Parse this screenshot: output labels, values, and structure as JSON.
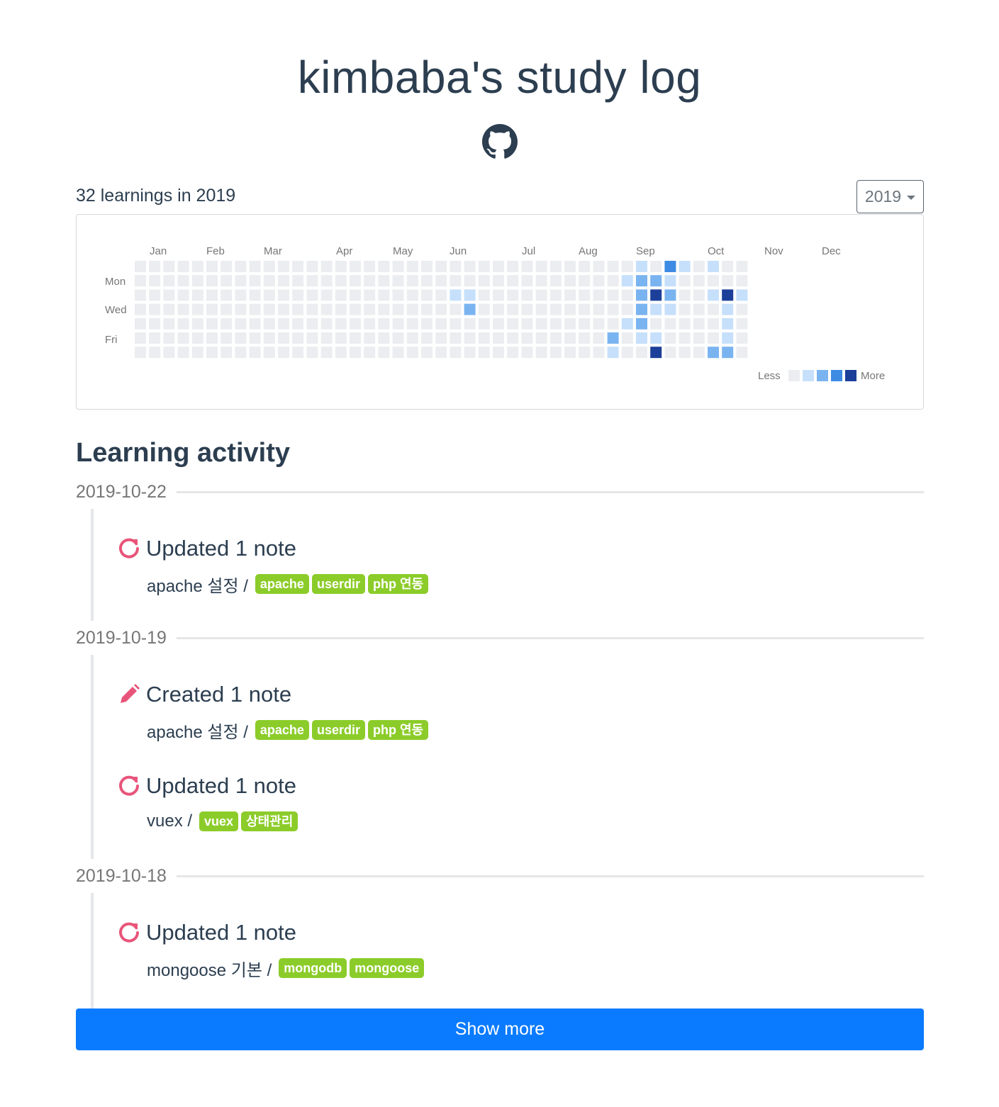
{
  "header": {
    "title": "kimbaba's study log",
    "github_icon": "github-icon"
  },
  "summary": {
    "text": "32 learnings in 2019",
    "year_selected": "2019"
  },
  "calendar": {
    "months": [
      "Jan",
      "Feb",
      "Mar",
      "Apr",
      "May",
      "Jun",
      "Jul",
      "Aug",
      "Sep",
      "Oct",
      "Nov",
      "Dec"
    ],
    "day_labels": [
      "Mon",
      "Wed",
      "Fri"
    ],
    "legend_less": "Less",
    "legend_more": "More",
    "colors": [
      "#ebedf0",
      "#c6e0fb",
      "#7ab4f0",
      "#3d8be3",
      "#1c3f99"
    ],
    "weeks": 43,
    "active": [
      {
        "week": 33,
        "day": 5,
        "level": 2
      },
      {
        "week": 33,
        "day": 6,
        "level": 1
      },
      {
        "week": 34,
        "day": 1,
        "level": 1
      },
      {
        "week": 34,
        "day": 4,
        "level": 1
      },
      {
        "week": 35,
        "day": 0,
        "level": 1
      },
      {
        "week": 35,
        "day": 1,
        "level": 2
      },
      {
        "week": 35,
        "day": 2,
        "level": 2
      },
      {
        "week": 35,
        "day": 3,
        "level": 2
      },
      {
        "week": 35,
        "day": 4,
        "level": 2
      },
      {
        "week": 35,
        "day": 5,
        "level": 1
      },
      {
        "week": 36,
        "day": 1,
        "level": 2
      },
      {
        "week": 36,
        "day": 2,
        "level": 4
      },
      {
        "week": 36,
        "day": 3,
        "level": 1
      },
      {
        "week": 36,
        "day": 5,
        "level": 1
      },
      {
        "week": 36,
        "day": 6,
        "level": 4
      },
      {
        "week": 37,
        "day": 0,
        "level": 3
      },
      {
        "week": 37,
        "day": 1,
        "level": 1
      },
      {
        "week": 37,
        "day": 2,
        "level": 2
      },
      {
        "week": 37,
        "day": 3,
        "level": 1
      },
      {
        "week": 38,
        "day": 0,
        "level": 1
      },
      {
        "week": 40,
        "day": 0,
        "level": 1
      },
      {
        "week": 40,
        "day": 2,
        "level": 1
      },
      {
        "week": 40,
        "day": 6,
        "level": 2
      },
      {
        "week": 41,
        "day": 2,
        "level": 4
      },
      {
        "week": 41,
        "day": 3,
        "level": 1
      },
      {
        "week": 41,
        "day": 4,
        "level": 1
      },
      {
        "week": 41,
        "day": 5,
        "level": 1
      },
      {
        "week": 41,
        "day": 6,
        "level": 2
      },
      {
        "week": 42,
        "day": 2,
        "level": 1
      },
      {
        "week": 22,
        "day": 2,
        "level": 1
      },
      {
        "week": 23,
        "day": 2,
        "level": 1
      },
      {
        "week": 23,
        "day": 3,
        "level": 2
      }
    ]
  },
  "activity": {
    "heading": "Learning activity",
    "groups": [
      {
        "date": "2019-10-22",
        "events": [
          {
            "icon": "refresh-icon",
            "title": "Updated 1 note",
            "note": "apache 설정 /",
            "tags": [
              "apache",
              "userdir",
              "php 연동"
            ]
          }
        ]
      },
      {
        "date": "2019-10-19",
        "events": [
          {
            "icon": "pencil-icon",
            "title": "Created 1 note",
            "note": "apache 설정 /",
            "tags": [
              "apache",
              "userdir",
              "php 연동"
            ]
          },
          {
            "icon": "refresh-icon",
            "title": "Updated 1 note",
            "note": "vuex /",
            "tags": [
              "vuex",
              "상태관리"
            ]
          }
        ]
      },
      {
        "date": "2019-10-18",
        "events": [
          {
            "icon": "refresh-icon",
            "title": "Updated 1 note",
            "note": "mongoose 기본 /",
            "tags": [
              "mongodb",
              "mongoose"
            ]
          }
        ]
      }
    ],
    "show_more": "Show more"
  }
}
